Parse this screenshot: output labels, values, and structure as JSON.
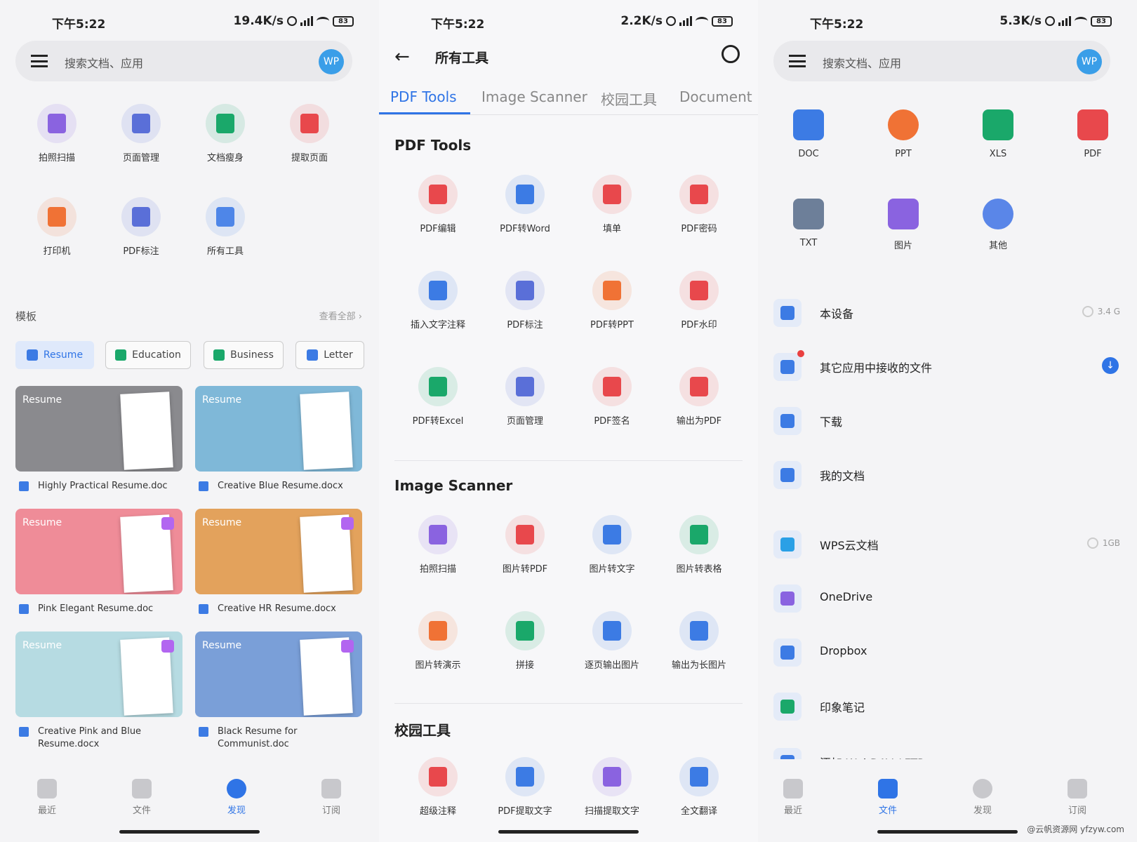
{
  "screen1": {
    "status": {
      "time": "下午5:22",
      "speed": "19.4K/s",
      "battery": "83"
    },
    "search": {
      "placeholder": "搜索文档、应用",
      "avatar": "WP"
    },
    "tools": [
      {
        "label": "拍照扫描",
        "color": "#8a63e0"
      },
      {
        "label": "页面管理",
        "color": "#5a6fd8"
      },
      {
        "label": "文档瘦身",
        "color": "#1aa86a"
      },
      {
        "label": "提取页面",
        "color": "#e8484c"
      },
      {
        "label": "打印机",
        "color": "#f07235"
      },
      {
        "label": "PDF标注",
        "color": "#5a6fd8"
      },
      {
        "label": "所有工具",
        "color": "#4e86e8"
      }
    ],
    "templates": {
      "heading": "模板",
      "view_all": "查看全部 ›",
      "chips": [
        "Resume",
        "Education",
        "Business",
        "Letter"
      ],
      "cards": [
        {
          "thumb_text": "Resume",
          "name": "Highly Practical Resume.doc",
          "color": "#8a8a8e",
          "vip": false
        },
        {
          "thumb_text": "Resume",
          "name": "Creative Blue Resume.docx",
          "color": "#7fb8d8",
          "vip": false
        },
        {
          "thumb_text": "Resume",
          "name": "Pink Elegant Resume.doc",
          "color": "#ef8c98",
          "vip": true
        },
        {
          "thumb_text": "Resume",
          "name": "Creative HR Resume.docx",
          "color": "#e3a25c",
          "vip": true
        },
        {
          "thumb_text": "Resume",
          "name": "Creative Pink and Blue Resume.docx",
          "color": "#b6dbe2",
          "vip": true
        },
        {
          "thumb_text": "Resume",
          "name": "Black Resume for Communist.doc",
          "color": "#7a9fd8",
          "vip": true
        }
      ]
    },
    "nav": [
      "最近",
      "文件",
      "发现",
      "订阅"
    ]
  },
  "screen2": {
    "status": {
      "time": "下午5:22",
      "speed": "2.2K/s",
      "battery": "83"
    },
    "title": "所有工具",
    "tabs": [
      "PDF Tools",
      "Image Scanner",
      "校园工具",
      "Document"
    ],
    "sections": [
      {
        "title": "PDF Tools",
        "items": [
          {
            "label": "PDF编辑",
            "color": "#e8484c"
          },
          {
            "label": "PDF转Word",
            "color": "#3c7be4"
          },
          {
            "label": "填单",
            "color": "#e8484c"
          },
          {
            "label": "PDF密码",
            "color": "#e8484c"
          },
          {
            "label": "插入文字注释",
            "color": "#3c7be4"
          },
          {
            "label": "PDF标注",
            "color": "#5a6fd8"
          },
          {
            "label": "PDF转PPT",
            "color": "#f07235"
          },
          {
            "label": "PDF水印",
            "color": "#e8484c"
          },
          {
            "label": "PDF转Excel",
            "color": "#1aa86a"
          },
          {
            "label": "页面管理",
            "color": "#5a6fd8"
          },
          {
            "label": "PDF签名",
            "color": "#e8484c"
          },
          {
            "label": "输出为PDF",
            "color": "#e8484c"
          }
        ]
      },
      {
        "title": "Image Scanner",
        "items": [
          {
            "label": "拍照扫描",
            "color": "#8a63e0"
          },
          {
            "label": "图片转PDF",
            "color": "#e8484c"
          },
          {
            "label": "图片转文字",
            "color": "#3c7be4"
          },
          {
            "label": "图片转表格",
            "color": "#1aa86a"
          },
          {
            "label": "图片转演示",
            "color": "#f07235"
          },
          {
            "label": "拼接",
            "color": "#1aa86a"
          },
          {
            "label": "逐页输出图片",
            "color": "#3c7be4"
          },
          {
            "label": "输出为长图片",
            "color": "#3c7be4"
          }
        ]
      },
      {
        "title": "校园工具",
        "items": [
          {
            "label": "超级注释",
            "color": "#e8484c"
          },
          {
            "label": "PDF提取文字",
            "color": "#3c7be4"
          },
          {
            "label": "扫描提取文字",
            "color": "#8a63e0"
          },
          {
            "label": "全文翻译",
            "color": "#3c7be4"
          }
        ]
      }
    ]
  },
  "screen3": {
    "status": {
      "time": "下午5:22",
      "speed": "5.3K/s",
      "battery": "83"
    },
    "search": {
      "placeholder": "搜索文档、应用",
      "avatar": "WP"
    },
    "file_types": [
      {
        "label": "DOC",
        "color": "#3c7be4"
      },
      {
        "label": "PPT",
        "color": "#f07235"
      },
      {
        "label": "XLS",
        "color": "#1aa86a"
      },
      {
        "label": "PDF",
        "color": "#e8484c"
      },
      {
        "label": "TXT",
        "color": "#6d7f99"
      },
      {
        "label": "图片",
        "color": "#8a63e0"
      },
      {
        "label": "其他",
        "color": "#5a86e8"
      }
    ],
    "locations": [
      {
        "name": "本设备",
        "extra": "3.4 G",
        "color": "#3c7be4"
      },
      {
        "name": "其它应用中接收的文件",
        "extra": "",
        "color": "#3c7be4"
      },
      {
        "name": "下载",
        "extra": "",
        "color": "#3c7be4"
      },
      {
        "name": "我的文档",
        "extra": "",
        "color": "#3c7be4"
      },
      {
        "name": "WPS云文档",
        "extra": "1GB",
        "color": "#2aa0e6"
      },
      {
        "name": "OneDrive",
        "extra": "",
        "color": "#8a63e0"
      },
      {
        "name": "Dropbox",
        "extra": "",
        "color": "#3c7be4"
      },
      {
        "name": "印象笔记",
        "extra": "",
        "color": "#1aa86a"
      },
      {
        "name": "添加 WebDAV / FTP",
        "extra": "",
        "color": "#3c7be4"
      }
    ],
    "nav": [
      "最近",
      "文件",
      "发现",
      "订阅"
    ],
    "watermark": "@云帆资源网 yfzyw.com"
  }
}
